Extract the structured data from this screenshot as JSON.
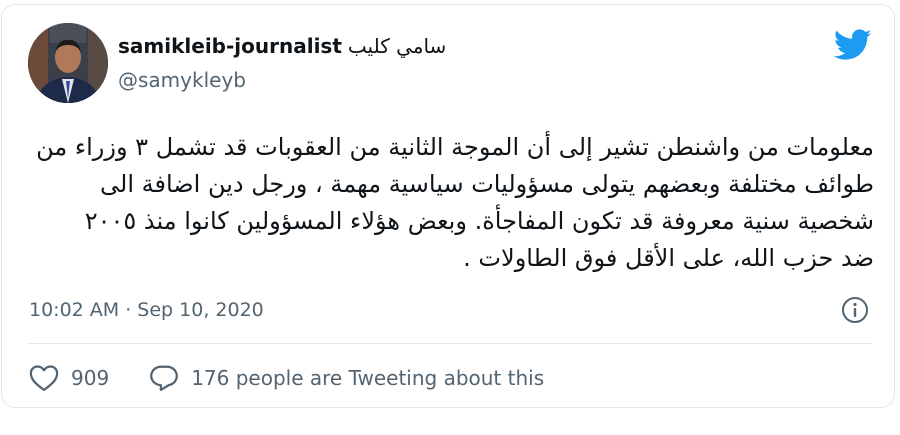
{
  "author": {
    "display_name": "samikleib-journalist",
    "display_name_arabic": "سامي كليب",
    "handle": "@samykleyb"
  },
  "tweet": {
    "lines": [
      "معلومات من واشنطن تشير إلى أن الموجة الثانية من العقوبات قد تشمل ٣ وزراء من",
      "طوائف مختلفة وبعضهم يتولى مسؤوليات سياسية مهمة ،  ورجل دين اضافة الى",
      "شخصية سنية معروفة قد تكون المفاجأة. وبعض هؤلاء المسؤولين كانوا منذ ٢٠٠٥",
      "ضد حزب الله، على الأقل فوق الطاولات ."
    ],
    "timestamp": "10:02 AM · Sep 10, 2020"
  },
  "actions": {
    "like_count": "909",
    "reply_label": "176 people are Tweeting about this"
  },
  "colors": {
    "twitter_blue": "#1d9bf0",
    "secondary_text": "#536471",
    "border": "#e1e8ed"
  },
  "icons": {
    "brand": "twitter-bird-icon",
    "info": "info-icon",
    "like": "heart-icon",
    "reply": "speech-bubble-icon"
  }
}
